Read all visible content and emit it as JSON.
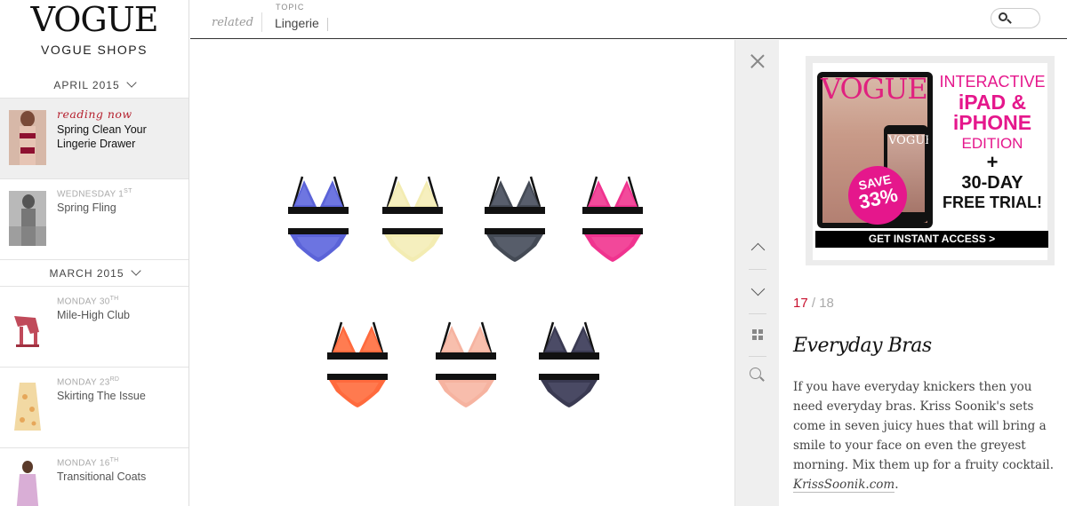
{
  "sidebar": {
    "logo": "VOGUE",
    "shops": "VOGUE SHOPS",
    "months": [
      {
        "label": "APRIL 2015"
      },
      {
        "label": "MARCH 2015"
      }
    ],
    "items": [
      {
        "reading": "reading now",
        "date": "",
        "title": "Spring Clean Your Lingerie Drawer",
        "active": true
      },
      {
        "date": "WEDNESDAY 1",
        "date_sup": "st",
        "title": "Spring Fling"
      },
      {
        "date": "MONDAY 30",
        "date_sup": "th",
        "title": "Mile-High Club"
      },
      {
        "date": "MONDAY 23",
        "date_sup": "rd",
        "title": "Skirting The Issue"
      },
      {
        "date": "MONDAY 16",
        "date_sup": "th",
        "title": "Transitional Coats"
      }
    ]
  },
  "topbar": {
    "related": "related",
    "topic_label": "TOPIC",
    "topic": "Lingerie"
  },
  "ad": {
    "mag": "VOGUE",
    "save_top": "SAVE",
    "save_pct": "33%",
    "line1": "INTERACTIVE",
    "line2": "iPAD &",
    "line2b": "iPHONE",
    "line3": "EDITION",
    "plus": "+",
    "line4": "30-DAY",
    "line5": "FREE TRIAL!",
    "cta": "GET INSTANT ACCESS >"
  },
  "article": {
    "current": "17",
    "total": "/ 18",
    "title": "Everyday Bras",
    "body": "If you have everyday knickers then you need everyday bras. Kriss Soonik's sets come in seven juicy hues that will bring a smile to your face on even the greyest morning. Mix them up for a fruity cocktail. ",
    "link": "KrissSoonik.com",
    "end": "."
  },
  "sets": [
    {
      "color": "#5b63d8",
      "lace": "#7e86ea"
    },
    {
      "color": "#f3ecb2",
      "lace": "#f7f2c9"
    },
    {
      "color": "#444a55",
      "lace": "#6a7080"
    },
    {
      "color": "#f0338f",
      "lace": "#f45ea6"
    },
    {
      "color": "#ff6a3d",
      "lace": "#ff8a62"
    },
    {
      "color": "#f6b3a0",
      "lace": "#f9c8b8"
    },
    {
      "color": "#3a3a52",
      "lace": "#5a5a76"
    }
  ],
  "colors": {
    "accent": "#c8102e",
    "ad_pink": "#e5178c"
  }
}
